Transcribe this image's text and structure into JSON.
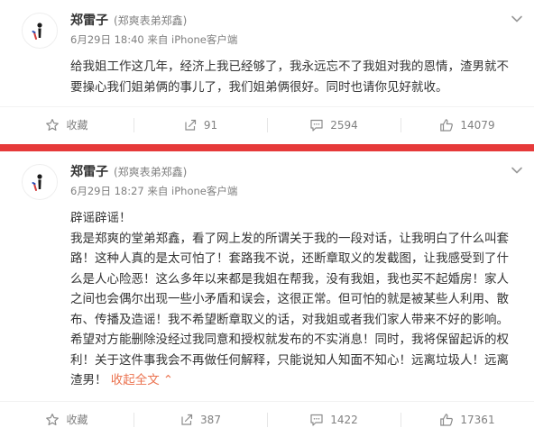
{
  "posts": [
    {
      "author": "郑雷子",
      "remark": "(郑爽表弟郑鑫)",
      "meta": "6月29日 18:40 来自 iPhone客户端",
      "text": "给我姐工作这几年，经济上我已经够了，我永远忘不了我姐对我的恩情，渣男就不要操心我们姐弟俩的事儿了，我们姐弟俩很好。同时也请你见好就收。",
      "actions": {
        "favorite": "收藏",
        "repost": "91",
        "comment": "2594",
        "like": "14079"
      }
    },
    {
      "author": "郑雷子",
      "remark": "(郑爽表弟郑鑫)",
      "meta": "6月29日 18:27 来自 iPhone客户端",
      "text_line1": "辟谣辟谣！",
      "text_body": "我是郑爽的堂弟郑鑫，看了网上发的所谓关于我的一段对话，让我明白了什么叫套路！这种人真的是太可怕了！套路我不说，还断章取义的发截图，让我感受到了什么是人心险恶！这么多年以来都是我姐在帮我，没有我姐，我也买不起婚房！家人之间也会偶尔出现一些小矛盾和误会，这很正常。但可怕的就是被某些人利用、散布、传播及造谣！我不希望断章取义的话，对我姐或者我们家人带来不好的影响。希望对方能删除没经过我同意和授权就发布的不实消息！同时，我将保留起诉的权利！关于这件事我会不再做任何解释，只能说知人知面不知心！远离垃圾人！远离渣男！",
      "collapse": "收起全文",
      "actions": {
        "favorite": "收藏",
        "repost": "387",
        "comment": "1422",
        "like": "17361"
      }
    }
  ],
  "colors": {
    "accent_red": "#e63a3a",
    "link_orange": "#eb7350",
    "meta_gray": "#808080"
  },
  "icons": [
    "avatar",
    "chevron-down-icon",
    "star-icon",
    "repost-icon",
    "comment-icon",
    "like-icon"
  ]
}
